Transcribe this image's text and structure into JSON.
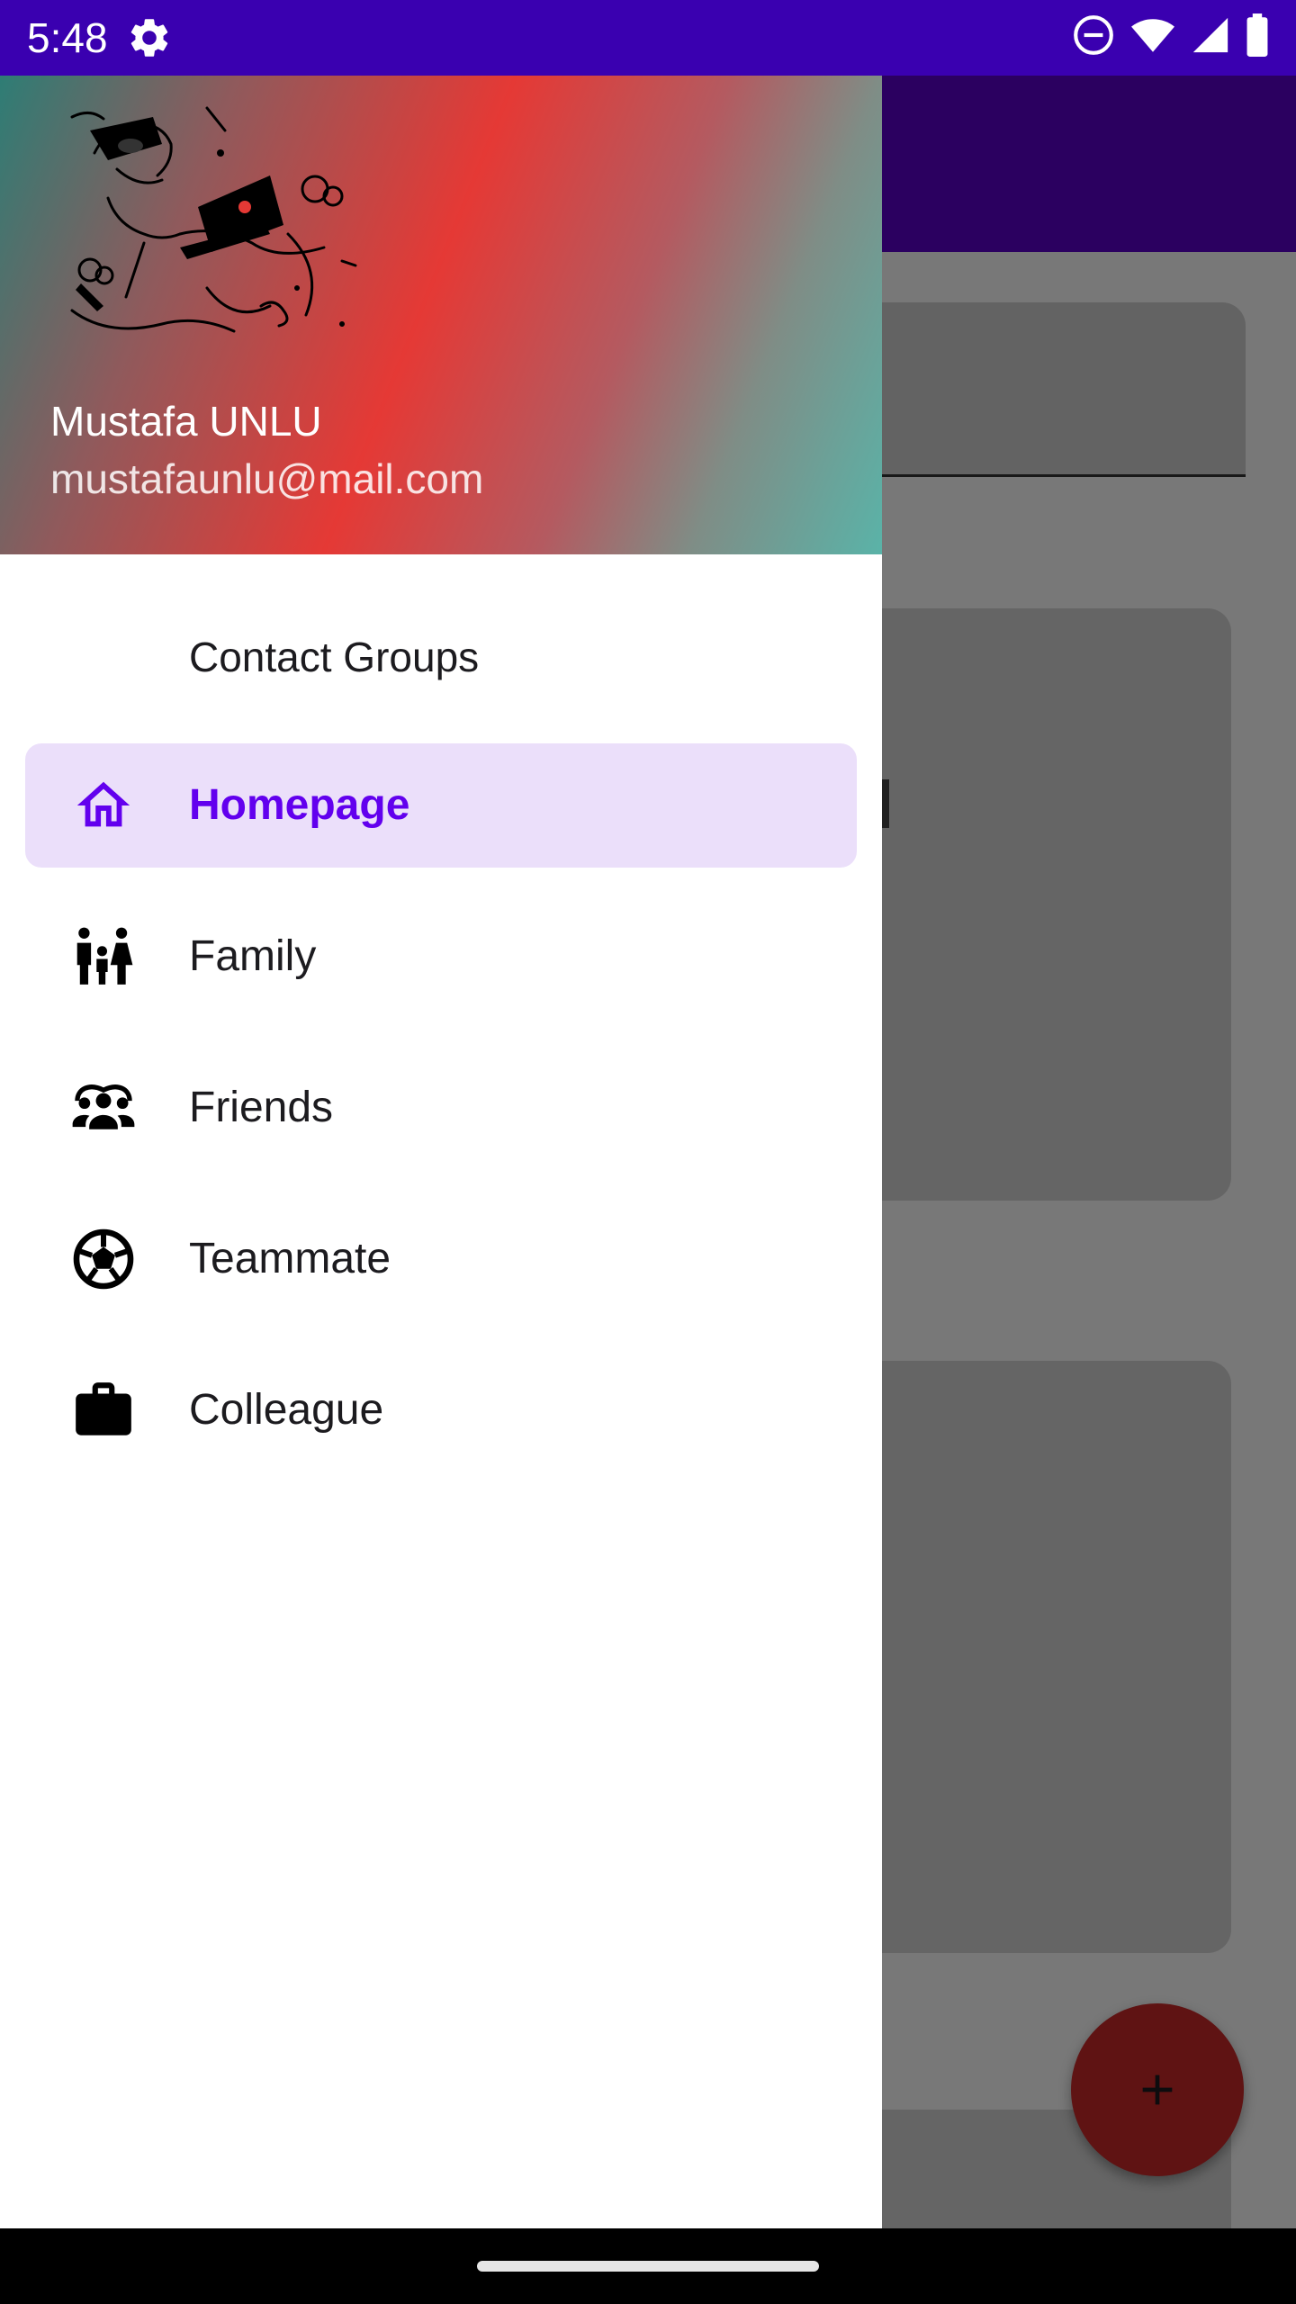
{
  "status_bar": {
    "time": "5:48"
  },
  "drawer": {
    "header": {
      "name": "Mustafa UNLU",
      "email": "mustafaunlu@mail.com"
    },
    "section_title": "Contact Groups",
    "items": [
      {
        "label": "Homepage",
        "icon": "home-icon",
        "active": true
      },
      {
        "label": "Family",
        "icon": "family-icon",
        "active": false
      },
      {
        "label": "Friends",
        "icon": "friends-icon",
        "active": false
      },
      {
        "label": "Teammate",
        "icon": "soccer-ball-icon",
        "active": false
      },
      {
        "label": "Colleague",
        "icon": "briefcase-icon",
        "active": false
      }
    ]
  },
  "fab": {
    "icon": "plus-icon"
  },
  "colors": {
    "status_bar": "#3a00b0",
    "toolbar": "#5a00c8",
    "accent": "#6200ee",
    "active_item_bg": "#ebdffa",
    "fab": "#c62828"
  }
}
